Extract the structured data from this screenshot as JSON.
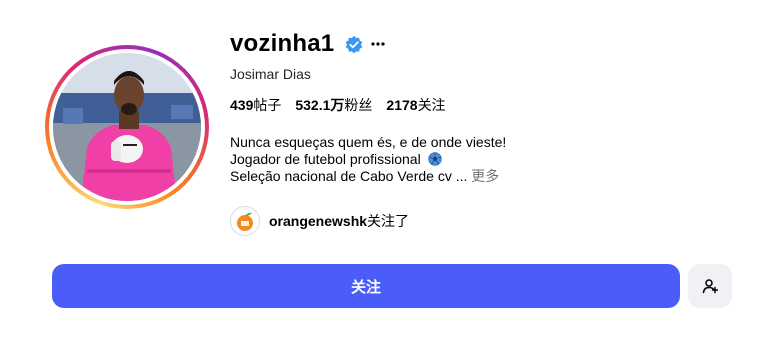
{
  "profile": {
    "username": "vozinha1",
    "full_name": "Josimar Dias",
    "verified": true,
    "verified_color": "#3897f0",
    "more_options_icon": "ellipsis-icon"
  },
  "stats": [
    {
      "value": "439",
      "label": "帖子"
    },
    {
      "value": "532.1万",
      "label": "粉丝"
    },
    {
      "value": "2178",
      "label": "关注"
    }
  ],
  "bio": {
    "line1": "Nunca esqueças quem és, e de onde vieste!",
    "line2": "Jogador de futebol profissional",
    "line2_icon": "soccer-ball-icon",
    "line3": "Seleção nacional de Cabo Verde cv ...",
    "more_label": "更多"
  },
  "followed_by": {
    "username": "orangenewshk",
    "suffix": "关注了"
  },
  "actions": {
    "follow_label": "关注",
    "follow_color": "#4a5df9",
    "suggest_icon": "add-person-icon"
  }
}
